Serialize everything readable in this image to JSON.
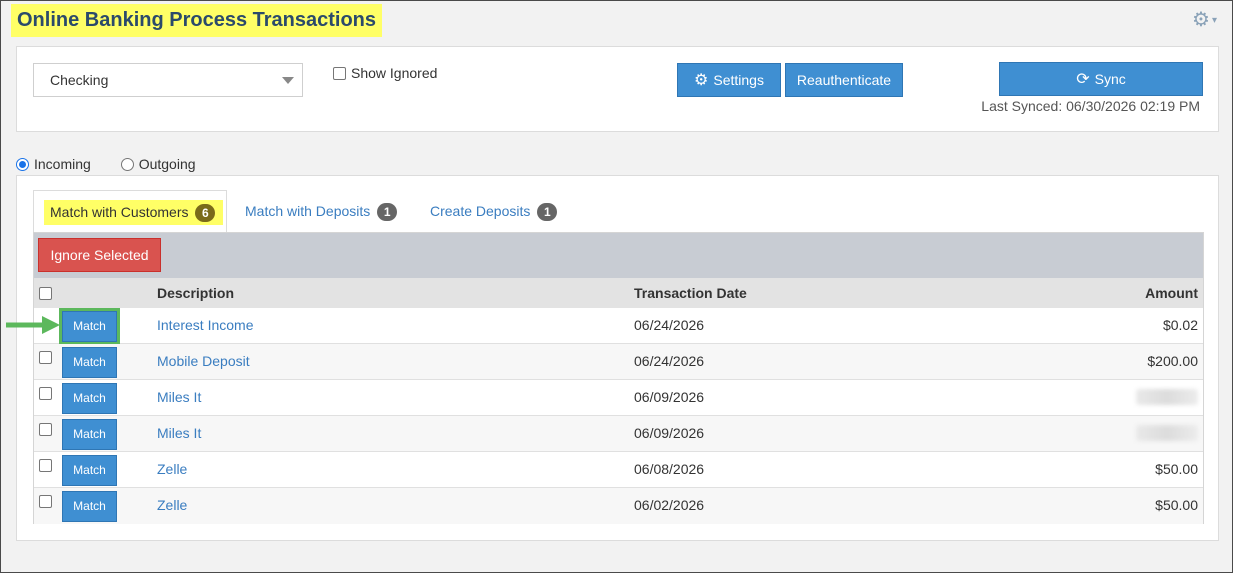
{
  "page": {
    "title": "Online Banking Process Transactions"
  },
  "header": {
    "settings_icon": "gear-icon",
    "settings_menu_caret": "▾"
  },
  "top_panel": {
    "account_select": {
      "selected": "Checking"
    },
    "show_ignored_label": "Show Ignored",
    "settings_label": "Settings",
    "reauthenticate_label": "Reauthenticate",
    "sync_label": "Sync",
    "last_synced": "Last Synced: 06/30/2026 02:19 PM"
  },
  "direction": {
    "incoming_label": "Incoming",
    "outgoing_label": "Outgoing",
    "selected": "Incoming"
  },
  "tabs": [
    {
      "label": "Match with Customers",
      "count": "6",
      "active": true
    },
    {
      "label": "Match with Deposits",
      "count": "1",
      "active": false
    },
    {
      "label": "Create Deposits",
      "count": "1",
      "active": false
    }
  ],
  "grid": {
    "ignore_selected_label": "Ignore Selected",
    "columns": {
      "description": "Description",
      "date": "Transaction Date",
      "amount": "Amount"
    },
    "match_label": "Match",
    "rows": [
      {
        "description": "Interest Income",
        "date": "06/24/2026",
        "amount": "$0.02"
      },
      {
        "description": "Mobile Deposit",
        "date": "06/24/2026",
        "amount": "$200.00"
      },
      {
        "description": "Miles It",
        "date": "06/09/2026",
        "amount": ""
      },
      {
        "description": "Miles It",
        "date": "06/09/2026",
        "amount": ""
      },
      {
        "description": "Zelle",
        "date": "06/08/2026",
        "amount": "$50.00"
      },
      {
        "description": "Zelle",
        "date": "06/02/2026",
        "amount": "$50.00"
      }
    ]
  },
  "colors": {
    "primary_button": "#3f8fd2",
    "danger_button": "#d9534f",
    "link": "#3a7dc0",
    "highlight": "#ffff66",
    "pointer_arrow": "#5cb85c"
  }
}
